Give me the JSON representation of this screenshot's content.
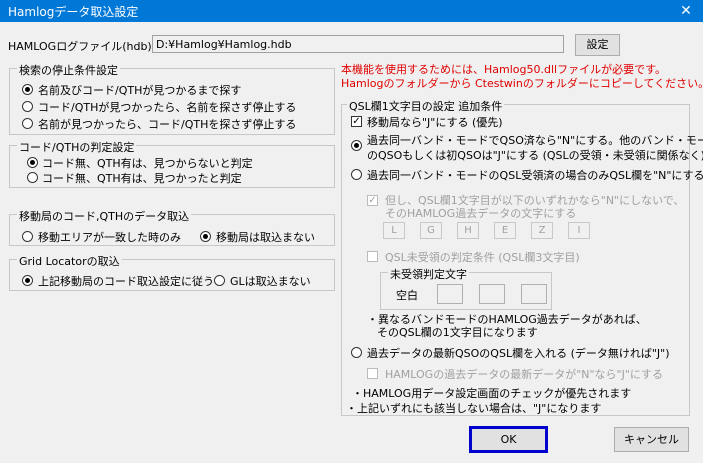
{
  "window": {
    "title": "Hamlogデータ取込設定",
    "close": "✕"
  },
  "file": {
    "label": "HAMLOGログファイル(hdb)",
    "path": "D:¥Hamlog¥Hamlog.hdb",
    "settings_button": "設定"
  },
  "notice": {
    "line1": "本機能を使用するためには、Hamlog50.dllファイルが必要です。",
    "line2": "Hamlogのフォルダーから Ctestwinのフォルダーにコピーしてください。"
  },
  "search_stop": {
    "title": "検索の停止条件設定",
    "options": [
      "名前及びコード/QTHが見つかるまで探す",
      "コード/QTHが見つかったら、名前を探さず停止する",
      "名前が見つかったら、コード/QTHを探さず停止する"
    ]
  },
  "code_qth_judge": {
    "title": "コード/QTHの判定設定",
    "options": [
      "コード無、QTH有は、見つからないと判定",
      "コード無、QTH有は、見つかったと判定"
    ]
  },
  "mobile": {
    "title": "移動局のコード,QTHのデータ取込",
    "options": [
      "移動エリアが一致した時のみ",
      "移動局は取込まない"
    ]
  },
  "grid": {
    "title": "Grid Locatorの取込",
    "options": [
      "上記移動局のコード取込設定に従う",
      "GLは取込まない"
    ]
  },
  "qsl": {
    "title": "QSL欄1文字目の設定 追加条件",
    "mobile_check": "移動局なら\"J\"にする (優先)",
    "option1_line1": "過去同一バンド・モードでQSO済なら\"N\"にする。他のバンド・モード",
    "option1_line2": "のQSOもしくは初QSOは\"J\"にする (QSLの受領・未受領に関係なく)",
    "option2": "過去同一バンド・モードのQSL受領済の場合のみQSL欄を\"N\"にする",
    "sub_check_line1": "但し、QSL欄1文字目が以下のいずれかなら\"N\"にしないで、",
    "sub_check_line2": "そのHAMLOG過去データの文字にする",
    "letters": [
      "L",
      "G",
      "H",
      "E",
      "Z",
      "I"
    ],
    "unreceived_check": "QSL未受領の判定条件 (QSL欄3文字目)",
    "unreceived_title": "未受領判定文字",
    "blank_label": "空白",
    "note_line1": "・異なるバンドモードのHAMLOG過去データがあれば、",
    "note_line2": "そのQSL欄の1文字目になります",
    "option3": "過去データの最新QSOのQSL欄を入れる (データ無ければ\"J\")",
    "latest_check": "HAMLOGの過去データの最新データが\"N\"なら\"J\"にする",
    "footer1": "・HAMLOG用データ設定画面のチェックが優先されます",
    "footer2": "・上記いずれにも該当しない場合は、\"J\"になります"
  },
  "buttons": {
    "ok": "OK",
    "cancel": "キャンセル"
  }
}
